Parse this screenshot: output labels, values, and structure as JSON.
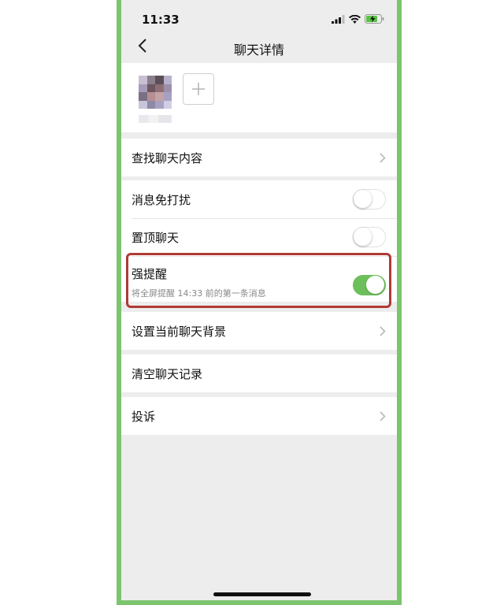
{
  "status_bar": {
    "time": "11:33",
    "icons": [
      "signal-icon",
      "wifi-icon",
      "battery-charging-icon"
    ]
  },
  "nav": {
    "back_icon": "chevron-left-icon",
    "title": "聊天详情"
  },
  "members": {
    "add_icon": "plus-icon"
  },
  "sections": {
    "search": {
      "label": "查找聊天内容"
    },
    "mute": {
      "label": "消息免打扰",
      "enabled": false
    },
    "pin": {
      "label": "置顶聊天",
      "enabled": false
    },
    "strong_reminder": {
      "label": "强提醒",
      "subtitle": "将全屏提醒 14:33 前的第一条消息",
      "enabled": true
    },
    "background": {
      "label": "设置当前聊天背景"
    },
    "clear": {
      "label": "清空聊天记录"
    },
    "report": {
      "label": "投诉"
    }
  },
  "colors": {
    "frame_border": "#7cc46e",
    "toggle_on": "#6cbf5a",
    "highlight_border": "#b03a35",
    "page_background": "#ededed"
  }
}
